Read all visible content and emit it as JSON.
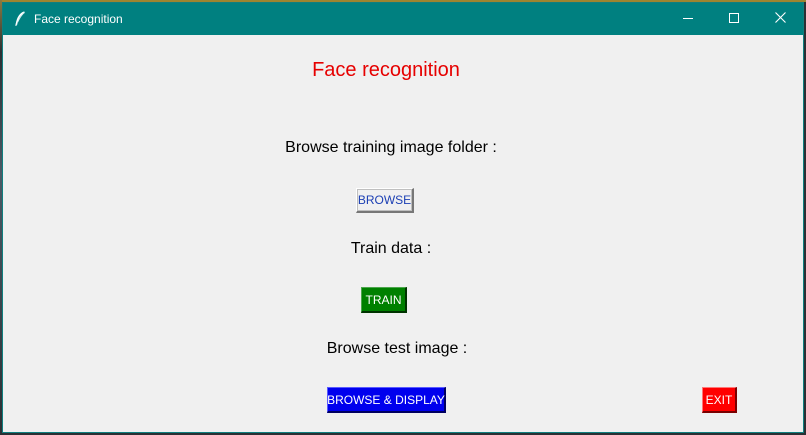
{
  "window": {
    "title": "Face recognition",
    "colors": {
      "titlebar": "#008080",
      "background": "#f0f0f0"
    },
    "controls": {
      "minimize_icon": "minimize-icon",
      "maximize_icon": "maximize-icon",
      "close_icon": "close-icon"
    }
  },
  "main": {
    "heading": "Face recognition",
    "training_label": "Browse training image folder :",
    "browse_button": "BROWSE",
    "train_label": "Train data :",
    "train_button": "TRAIN",
    "test_label": "Browse test image :",
    "display_button": "BROWSE & DISPLAY",
    "exit_button": "EXIT"
  },
  "colors": {
    "heading": "#e60000",
    "browse_text": "#1c3fb4",
    "train": "#008000",
    "display": "#0000ee",
    "exit": "#ff0000"
  }
}
